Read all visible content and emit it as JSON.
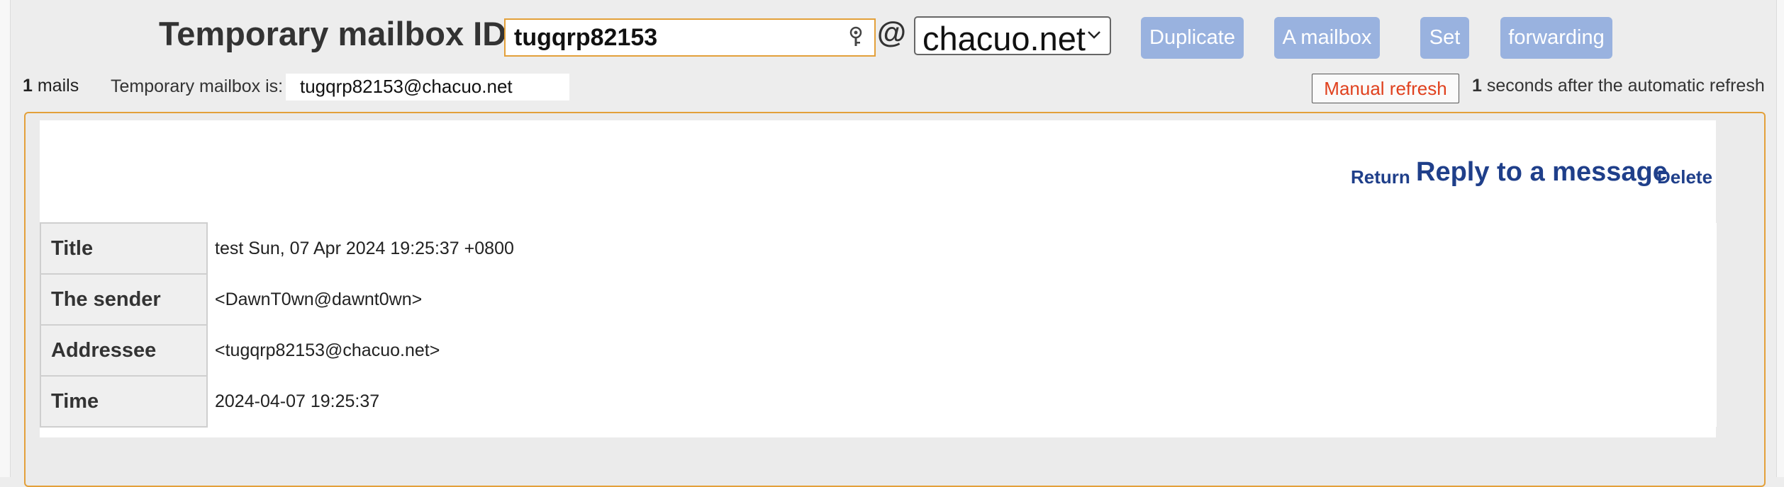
{
  "header": {
    "id_label": "Temporary mailbox ID:",
    "id_value": "tugqrp82153",
    "at": "@",
    "domain": "chacuo.net",
    "buttons": {
      "duplicate": "Duplicate",
      "mailbox": "A mailbox",
      "set": "Set",
      "forwarding": "forwarding"
    }
  },
  "status": {
    "mail_count": "1",
    "mail_count_label": " mails",
    "box_label": "Temporary mailbox is:",
    "box_address": "tugqrp82153@chacuo.net",
    "manual_refresh": "Manual refresh",
    "refresh_seconds": "1",
    "refresh_text": " seconds after the automatic refresh"
  },
  "message": {
    "actions": {
      "return": "Return",
      "reply": "Reply to a message",
      "delete": "Delete"
    },
    "fields": [
      {
        "label": "Title",
        "value": "test Sun, 07 Apr 2024 19:25:37 +0800"
      },
      {
        "label": "The sender",
        "value": "<DawnT0wn@dawnt0wn>"
      },
      {
        "label": "Addressee",
        "value": "<tugqrp82153@chacuo.net>"
      },
      {
        "label": "Time",
        "value": "2024-04-07 19:25:37"
      }
    ]
  },
  "colors": {
    "accent_border": "#e3a03a",
    "button_bg": "#99b2df",
    "link": "#1f3f8a",
    "refresh_text": "#e0411e"
  },
  "icons": [
    "key-icon",
    "chevron-down-icon"
  ]
}
